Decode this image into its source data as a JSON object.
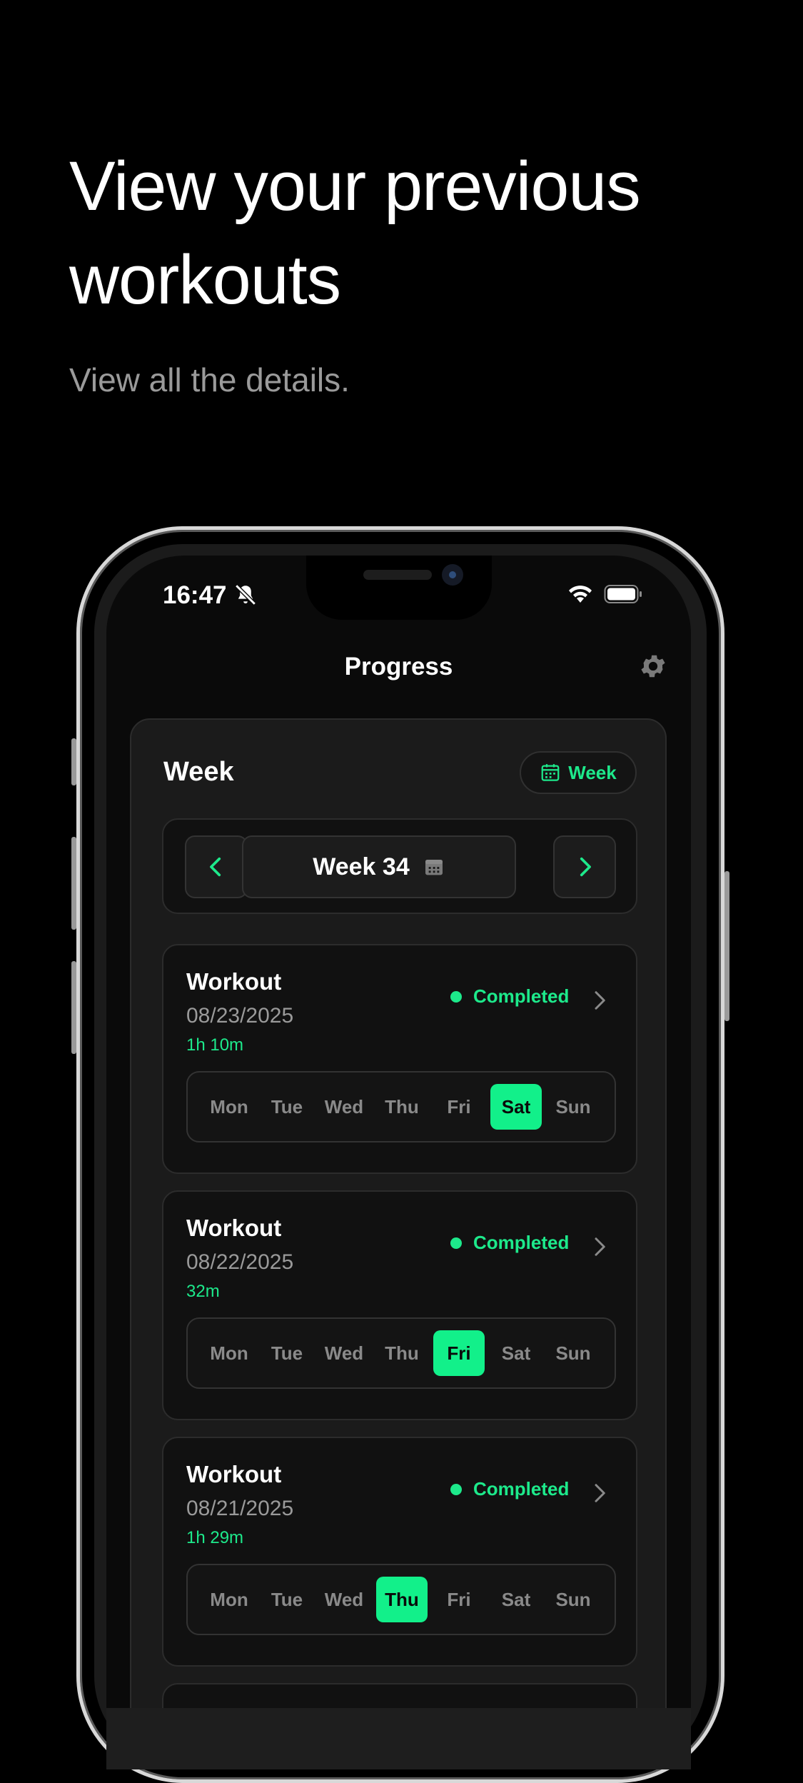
{
  "hero": {
    "headline": "View your previous workouts",
    "subline": "View all the details."
  },
  "status_bar": {
    "time": "16:47"
  },
  "nav": {
    "title": "Progress",
    "settings_icon": "gear-icon"
  },
  "week_card": {
    "title": "Week",
    "toggle_label": "Week",
    "week_label": "Week 34"
  },
  "colors": {
    "accent": "#12f08a",
    "background": "#000000",
    "card": "#1b1b1b"
  },
  "days": [
    "Mon",
    "Tue",
    "Wed",
    "Thu",
    "Fri",
    "Sat",
    "Sun"
  ],
  "workouts": [
    {
      "title": "Workout",
      "date": "08/23/2025",
      "duration": "1h 10m",
      "status": "Completed",
      "active_day": "Sat"
    },
    {
      "title": "Workout",
      "date": "08/22/2025",
      "duration": "32m",
      "status": "Completed",
      "active_day": "Fri"
    },
    {
      "title": "Workout",
      "date": "08/21/2025",
      "duration": "1h 29m",
      "status": "Completed",
      "active_day": "Thu"
    }
  ]
}
